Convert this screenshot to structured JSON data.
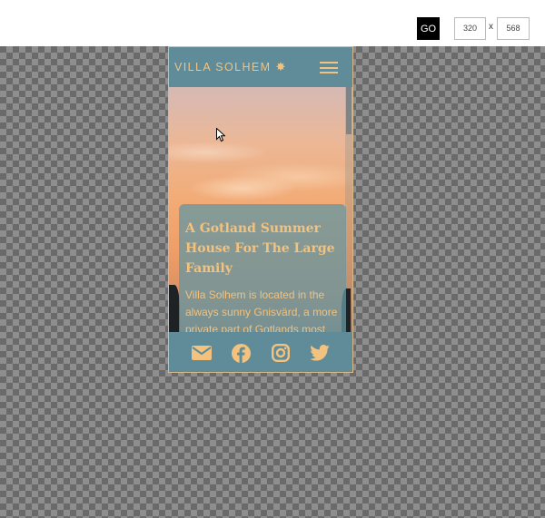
{
  "toolbar": {
    "go_label": "GO",
    "width_value": "320",
    "separator": "x",
    "height_value": "568"
  },
  "site": {
    "logo_text": "VILLA SOLHEM",
    "logo_icon": "sun-icon",
    "menu_icon": "hamburger-menu-icon"
  },
  "hero": {
    "title": "A Gotland Summer House For The Large Family",
    "body": "Villa Solhem is located in the always sunny Gnisvärd, a more private part of Gotlands most"
  },
  "footer": {
    "icons": [
      "mail-icon",
      "facebook-icon",
      "instagram-icon",
      "twitter-icon"
    ]
  },
  "colors": {
    "accent": "#f2c27e",
    "header_bg": "#5f8c98"
  }
}
